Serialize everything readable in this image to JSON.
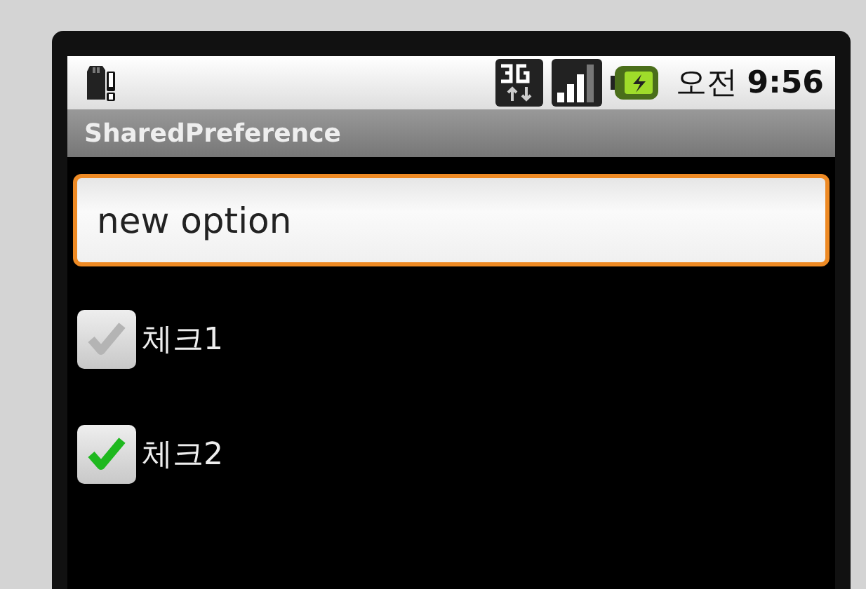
{
  "status_bar": {
    "time": "오전 **9:56**"
  },
  "title_bar": {
    "title": "SharedPreference"
  },
  "text_field": {
    "value": "new option",
    "focused": true
  },
  "checkboxes": [
    {
      "label": "체크1",
      "checked": false
    },
    {
      "label": "체크2",
      "checked": true
    }
  ]
}
